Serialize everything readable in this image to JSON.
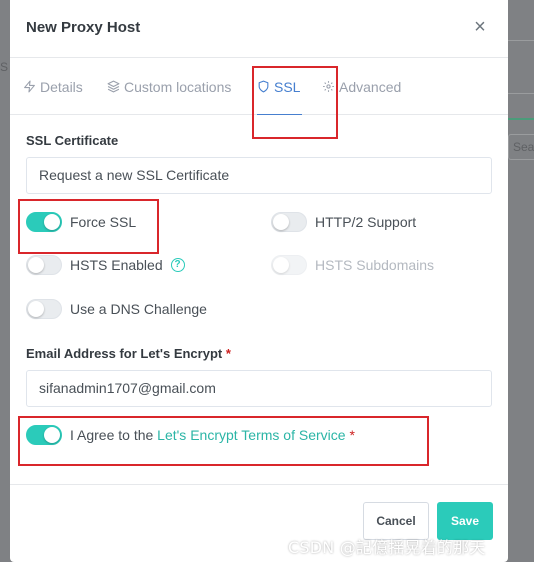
{
  "background": {
    "left_fragment": "S",
    "search_fragment": "Sea"
  },
  "modal": {
    "title": "New Proxy Host",
    "close_glyph": "×"
  },
  "tabs": [
    {
      "label": "Details",
      "icon": "bolt-icon",
      "active": false
    },
    {
      "label": "Custom locations",
      "icon": "layers-icon",
      "active": false
    },
    {
      "label": "SSL",
      "icon": "shield-icon",
      "active": true
    },
    {
      "label": "Advanced",
      "icon": "gear-icon",
      "active": false
    }
  ],
  "ssl": {
    "certificate_label": "SSL Certificate",
    "certificate_value": "Request a new SSL Certificate",
    "force_ssl": {
      "label": "Force SSL",
      "on": true
    },
    "http2": {
      "label": "HTTP/2 Support",
      "on": false
    },
    "hsts_enabled": {
      "label": "HSTS Enabled",
      "on": false
    },
    "hsts_subdomains": {
      "label": "HSTS Subdomains",
      "on": false,
      "disabled": true
    },
    "dns_challenge": {
      "label": "Use a DNS Challenge",
      "on": false
    },
    "email_label": "Email Address for Let's Encrypt",
    "email_required": "*",
    "email_value": "sifanadmin1707@gmail.com",
    "agree": {
      "prefix": "I Agree to the ",
      "link": "Let's Encrypt Terms of Service",
      "required": "*",
      "on": true
    }
  },
  "footer": {
    "cancel_label": "Cancel",
    "save_label": "Save"
  },
  "watermark": "CSDN @記億揺晃着的那天",
  "colors": {
    "accent_teal": "#2bcbba",
    "tab_active": "#467fcf",
    "highlight_red": "#d9262b",
    "required_red": "#cd201f"
  }
}
